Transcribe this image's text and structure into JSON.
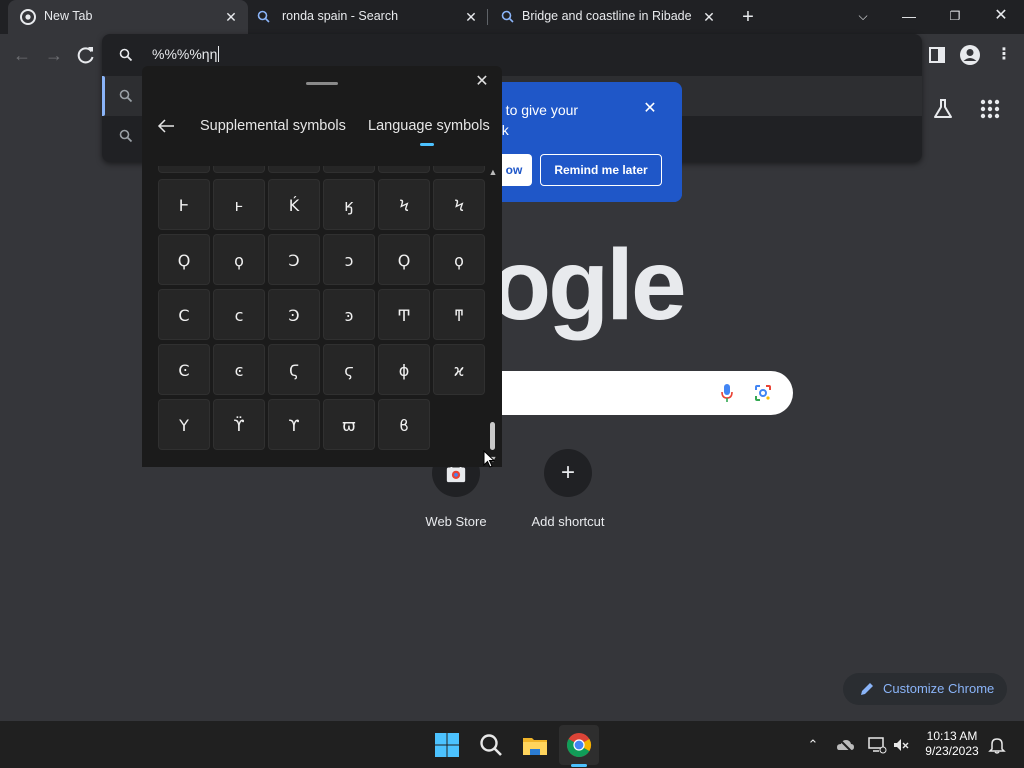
{
  "tabs": [
    {
      "title": "New Tab",
      "icon": "chrome-icon",
      "active": true
    },
    {
      "title": "ronda spain - Search",
      "icon": "search-icon",
      "active": false
    },
    {
      "title": "Bridge and coastline in Ribadeo,",
      "icon": "search-icon",
      "active": false
    }
  ],
  "omnibox": {
    "value": "%%%%ηη"
  },
  "promo": {
    "text": "...e to give your ...ok",
    "line1": "e to give your",
    "line2": "ok",
    "button_primary": "ow",
    "button_secondary": "Remind me later"
  },
  "logo_text": "ogle",
  "shortcuts": [
    {
      "label": "Web Store"
    },
    {
      "label": "Add shortcut"
    }
  ],
  "customize_label": "Customize Chrome",
  "symbol_panel": {
    "tabs": [
      "Supplemental symbols",
      "Language symbols"
    ],
    "active_tab": "Language symbols",
    "rows": [
      [
        "Ͱ",
        "ͱ",
        "Ḱ",
        "ӄ",
        "Ϟ",
        "Ϟ"
      ],
      [
        "Ϙ",
        "ϙ",
        "Ͻ",
        "ͻ",
        "Ϙ",
        "ϙ"
      ],
      [
        "Ϲ",
        "ϲ",
        "Ͽ",
        "ͽ",
        "Ͳ",
        "ͳ"
      ],
      [
        "Ͼ",
        "ͼ",
        "Ϛ",
        "ϛ",
        "ϕ",
        "ϰ"
      ],
      [
        "Υ",
        "ϔ",
        "ϒ",
        "ϖ",
        "ϐ"
      ]
    ]
  },
  "taskbar": {
    "time": "10:13 AM",
    "date": "9/23/2023"
  },
  "colors": {
    "accent": "#8ab4f8",
    "promo_bg": "#1f57c8",
    "panel_bg": "#1b1b1b",
    "page_bg": "#35363a"
  }
}
